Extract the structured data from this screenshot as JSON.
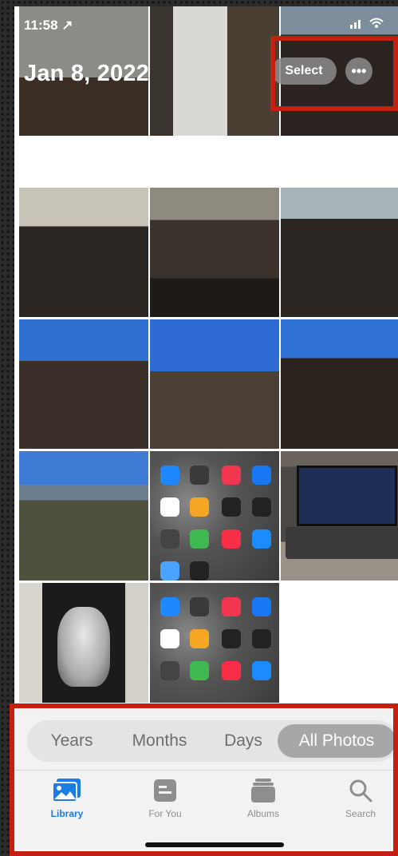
{
  "status_bar": {
    "time": "11:58 ↗"
  },
  "header": {
    "date": "Jan 8, 2022",
    "select_label": "Select",
    "more_label": "•••"
  },
  "segmented_control": {
    "options": [
      "Years",
      "Months",
      "Days",
      "All Photos"
    ],
    "selected": "All Photos"
  },
  "tab_bar": {
    "tabs": [
      {
        "label": "Library",
        "icon": "photo-library-icon",
        "active": true
      },
      {
        "label": "For You",
        "icon": "for-you-icon",
        "active": false
      },
      {
        "label": "Albums",
        "icon": "albums-icon",
        "active": false
      },
      {
        "label": "Search",
        "icon": "search-icon",
        "active": false
      }
    ]
  },
  "colors": {
    "accent": "#1a7de6",
    "highlight_box": "#c42012"
  }
}
